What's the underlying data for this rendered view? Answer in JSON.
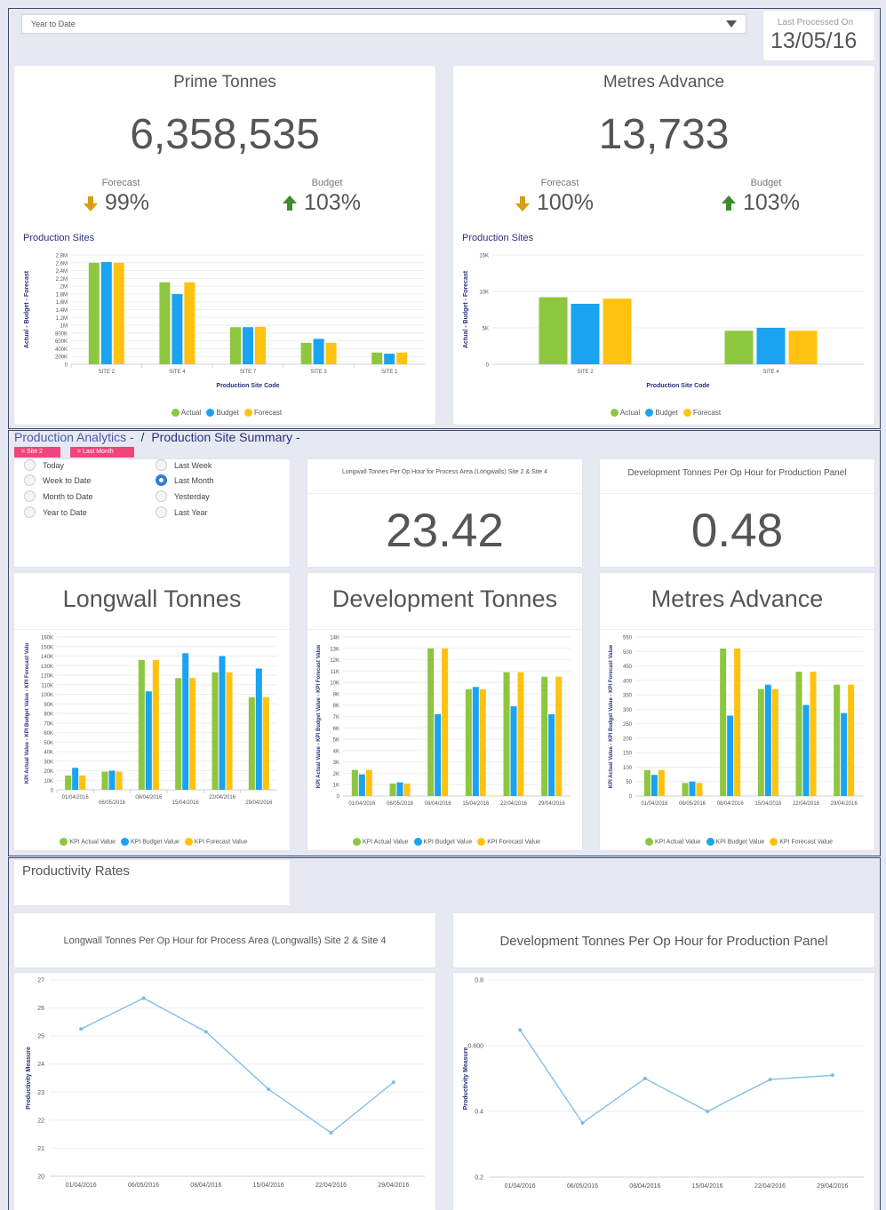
{
  "colors": {
    "actual": "#8dc63f",
    "budget": "#1aa3f0",
    "forecast": "#ffc20e",
    "line": "#7dbbe8",
    "navy": "#2a2f7d",
    "pink": "#f0457b",
    "down": "#d89c10",
    "up": "#3d8b2a"
  },
  "period_select": {
    "value": "Year to Date",
    "icon": "triangle-down-icon"
  },
  "last_processed": {
    "label": "Last Processed On",
    "value": "13/05/16"
  },
  "prime": {
    "title": "Prime Tonnes",
    "value": "6,358,535",
    "forecast_label": "Forecast",
    "forecast_pct": "99%",
    "forecast_icon": "arrow-down-icon",
    "budget_label": "Budget",
    "budget_pct": "103%",
    "budget_icon": "arrow-up-icon",
    "chart_title": "Production Sites"
  },
  "metres": {
    "title": "Metres Advance",
    "value": "13,733",
    "forecast_label": "Forecast",
    "forecast_pct": "100%",
    "forecast_icon": "arrow-down-icon",
    "budget_label": "Budget",
    "budget_pct": "103%",
    "budget_icon": "arrow-up-icon",
    "chart_title": "Production Sites"
  },
  "breadcrumb": {
    "item1": "Production Analytics",
    "sep": "-",
    "slash": "/",
    "item2": "Production Site Summary",
    "sep2": "-"
  },
  "filter_chips": [
    "= Site 2",
    "= Last Month"
  ],
  "radio_options": [
    {
      "label": "Today",
      "checked": false
    },
    {
      "label": "Last Week",
      "checked": false
    },
    {
      "label": "Week to Date",
      "checked": false
    },
    {
      "label": "Last Month",
      "checked": true
    },
    {
      "label": "Month to Date",
      "checked": false
    },
    {
      "label": "Yesterday",
      "checked": false
    },
    {
      "label": "Year to Date",
      "checked": false
    },
    {
      "label": "Last Year",
      "checked": false
    }
  ],
  "kpi1": {
    "title": "Longwall Tonnes Per Op Hour for Process Area (Longwalls) Site 2 & Site 4",
    "value": "23.42"
  },
  "kpi2": {
    "title": "Development Tonnes Per Op Hour for Production Panel",
    "value": "0.48"
  },
  "panels": {
    "longwall": "Longwall Tonnes",
    "development": "Development Tonnes",
    "metres": "Metres Advance"
  },
  "kpi_legend": {
    "actual": "KPI Actual Value",
    "budget": "KPI Budget Value",
    "forecast": "KPI Forecast Value"
  },
  "productivity": {
    "section_title": "Productivity Rates",
    "chart1_title": "Longwall Tonnes Per Op Hour for Process Area (Longwalls) Site 2 & Site 4",
    "chart2_title": "Development Tonnes Per Op Hour for Production Panel"
  },
  "chart_data": [
    {
      "id": "prime-sites",
      "type": "bar",
      "title": "Production Sites",
      "xlabel": "Production Site Code",
      "ylabel": "Actual - Budget - Forecast",
      "categories": [
        "SITE 2",
        "SITE 4",
        "SITE 7",
        "SITE 3",
        "SITE 1"
      ],
      "series": [
        {
          "name": "Actual",
          "values": [
            2600000,
            2100000,
            950000,
            550000,
            300000
          ]
        },
        {
          "name": "Budget",
          "values": [
            2620000,
            1800000,
            950000,
            650000,
            270000
          ]
        },
        {
          "name": "Forecast",
          "values": [
            2600000,
            2100000,
            960000,
            550000,
            300000
          ]
        }
      ],
      "ylim": [
        0,
        2800000
      ],
      "yticks": [
        "0",
        "200K",
        "400K",
        "600K",
        "800K",
        "1M",
        "1.2M",
        "1.4M",
        "1.6M",
        "1.8M",
        "2M",
        "2.2M",
        "2.4M",
        "2.6M",
        "2.8M"
      ],
      "legend": "bottom"
    },
    {
      "id": "metres-sites",
      "type": "bar",
      "title": "Production Sites",
      "xlabel": "Production Site Code",
      "ylabel": "Actual - Budget - Forecast",
      "categories": [
        "SITE 2",
        "SITE 4"
      ],
      "series": [
        {
          "name": "Actual",
          "values": [
            9200,
            4600
          ]
        },
        {
          "name": "Budget",
          "values": [
            8300,
            5000
          ]
        },
        {
          "name": "Forecast",
          "values": [
            9000,
            4600
          ]
        }
      ],
      "ylim": [
        0,
        15000
      ],
      "yticks": [
        "0",
        "5K",
        "10K",
        "15K"
      ],
      "legend": "bottom"
    },
    {
      "id": "longwall-kpi",
      "type": "bar",
      "title": "Longwall Tonnes",
      "ylabel": "KPI Actual Value - KPI Budget Value - KPI Forecast Valu",
      "categories": [
        "01/04/2016",
        "06/05/2016",
        "08/04/2016",
        "15/04/2016",
        "22/04/2016",
        "29/04/2016"
      ],
      "series": [
        {
          "name": "KPI Actual Value",
          "values": [
            15000,
            19000,
            136000,
            117000,
            123000,
            97000
          ]
        },
        {
          "name": "KPI Budget Value",
          "values": [
            23000,
            20000,
            103000,
            143000,
            140000,
            127000
          ]
        },
        {
          "name": "KPI Forecast Value",
          "values": [
            15000,
            19000,
            136000,
            117000,
            123000,
            97000
          ]
        }
      ],
      "ylim": [
        0,
        160000
      ],
      "yticks": [
        "0",
        "10K",
        "20K",
        "30K",
        "40K",
        "50K",
        "60K",
        "70K",
        "80K",
        "90K",
        "100K",
        "110K",
        "120K",
        "130K",
        "140K",
        "150K",
        "160K"
      ],
      "legend": "bottom"
    },
    {
      "id": "development-kpi",
      "type": "bar",
      "title": "Development Tonnes",
      "ylabel": "KPI Actual Value - KPI Budget Value - KPI Forecast Value",
      "categories": [
        "01/04/2016",
        "06/05/2016",
        "08/04/2016",
        "15/04/2016",
        "22/04/2016",
        "29/04/2016"
      ],
      "series": [
        {
          "name": "KPI Actual Value",
          "values": [
            2300,
            1100,
            13000,
            9400,
            10900,
            10500
          ]
        },
        {
          "name": "KPI Budget Value",
          "values": [
            1900,
            1200,
            7200,
            9600,
            7900,
            7200
          ]
        },
        {
          "name": "KPI Forecast Value",
          "values": [
            2300,
            1100,
            13000,
            9400,
            10900,
            10500
          ]
        }
      ],
      "ylim": [
        0,
        14000
      ],
      "yticks": [
        "0",
        "1K",
        "2K",
        "3K",
        "4K",
        "5K",
        "6K",
        "7K",
        "8K",
        "9K",
        "10K",
        "11K",
        "12K",
        "13K",
        "14K"
      ],
      "legend": "bottom"
    },
    {
      "id": "metres-kpi",
      "type": "bar",
      "title": "Metres Advance",
      "ylabel": "KPI Actual Value - KPI Budget Value - KPI Forecast Value",
      "categories": [
        "01/04/2016",
        "06/05/2016",
        "08/04/2016",
        "15/04/2016",
        "22/04/2016",
        "29/04/2016"
      ],
      "series": [
        {
          "name": "KPI Actual Value",
          "values": [
            90,
            45,
            510,
            370,
            430,
            385
          ]
        },
        {
          "name": "KPI Budget Value",
          "values": [
            73,
            50,
            278,
            385,
            315,
            287
          ]
        },
        {
          "name": "KPI Forecast Value",
          "values": [
            90,
            45,
            510,
            370,
            430,
            385
          ]
        }
      ],
      "ylim": [
        0,
        550
      ],
      "yticks": [
        "0",
        "50",
        "100",
        "150",
        "200",
        "250",
        "300",
        "350",
        "400",
        "450",
        "500",
        "550"
      ],
      "legend": "bottom"
    },
    {
      "id": "longwall-productivity",
      "type": "line",
      "title": "Longwall Tonnes Per Op Hour for Process Area (Longwalls) Site 2 & Site 4",
      "ylabel": "Productivity Measure",
      "x": [
        "01/04/2016",
        "06/05/2016",
        "08/04/2016",
        "15/04/2016",
        "22/04/2016",
        "29/04/2016"
      ],
      "values": [
        25.25,
        26.35,
        25.15,
        23.1,
        21.55,
        23.35
      ],
      "ylim": [
        20,
        27
      ],
      "yticks": [
        "20",
        "21",
        "22",
        "23",
        "24",
        "25",
        "26",
        "27"
      ]
    },
    {
      "id": "development-productivity",
      "type": "line",
      "title": "Development Tonnes Per Op Hour for Production Panel",
      "ylabel": "Productivity Measure",
      "x": [
        "01/04/2016",
        "06/05/2016",
        "08/04/2016",
        "15/04/2016",
        "22/04/2016",
        "29/04/2016"
      ],
      "values": [
        0.648,
        0.365,
        0.5,
        0.4,
        0.497,
        0.51
      ],
      "ylim": [
        0.2,
        0.8
      ],
      "yticks": [
        "0.2",
        "0.4",
        "0.600",
        "0.8"
      ]
    }
  ]
}
